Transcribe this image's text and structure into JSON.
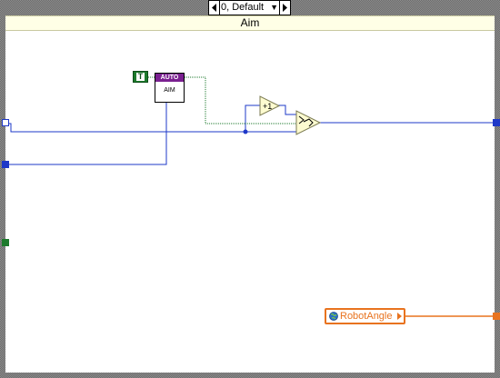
{
  "case_structure": {
    "selector_label": "0, Default",
    "subdiagram_label": "Aim"
  },
  "nodes": {
    "boolean_constant": "T",
    "subvi_banner": "AUTO",
    "subvi_name": "AIM",
    "increment_label": "+1",
    "global_variable": "RobotAngle"
  },
  "colors": {
    "numeric_wire": "#1e38c8",
    "boolean_wire": "#1d7a2c",
    "global_wire": "#e8731f",
    "subdiagram_label_bg": "#ffffe6",
    "subvi_banner": "#7a2090"
  }
}
